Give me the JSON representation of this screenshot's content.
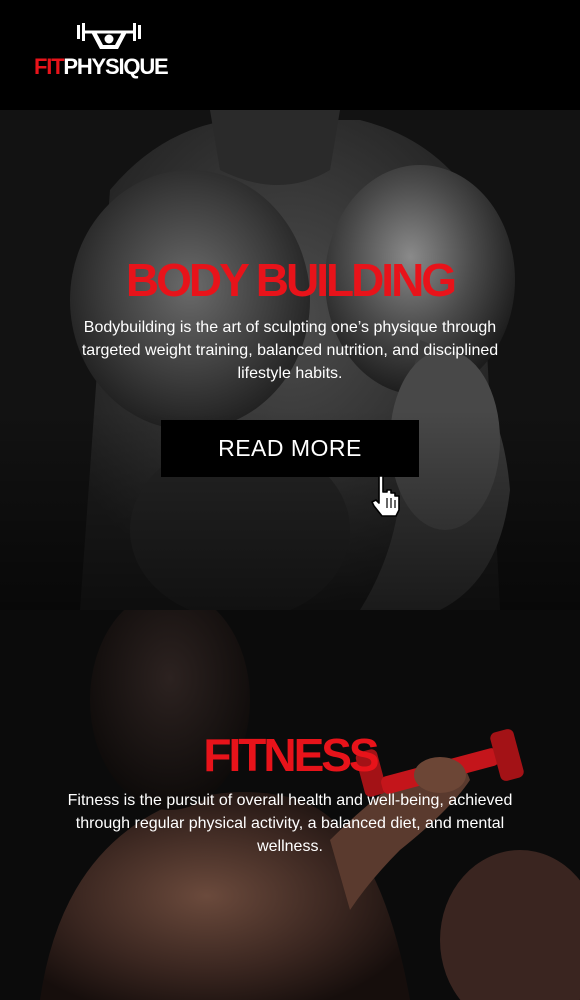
{
  "header": {
    "logo": {
      "fit": "FIT",
      "physique": "PHYSIQUE"
    }
  },
  "sections": [
    {
      "title": "BODY BUILDING",
      "description": "Bodybuilding is the art of sculpting one’s physique through targeted weight training, balanced nutrition, and disciplined lifestyle habits.",
      "button_label": "READ MORE"
    },
    {
      "title": "FITNESS",
      "description": "Fitness is the pursuit of overall health and well-being, achieved through regular physical activity, a balanced diet, and mental wellness."
    }
  ],
  "colors": {
    "accent": "#e8131a",
    "background": "#000000",
    "text": "#ffffff"
  },
  "icons": {
    "logo_mark": "barbell-figure-icon",
    "cursor": "hand-pointer-icon"
  }
}
